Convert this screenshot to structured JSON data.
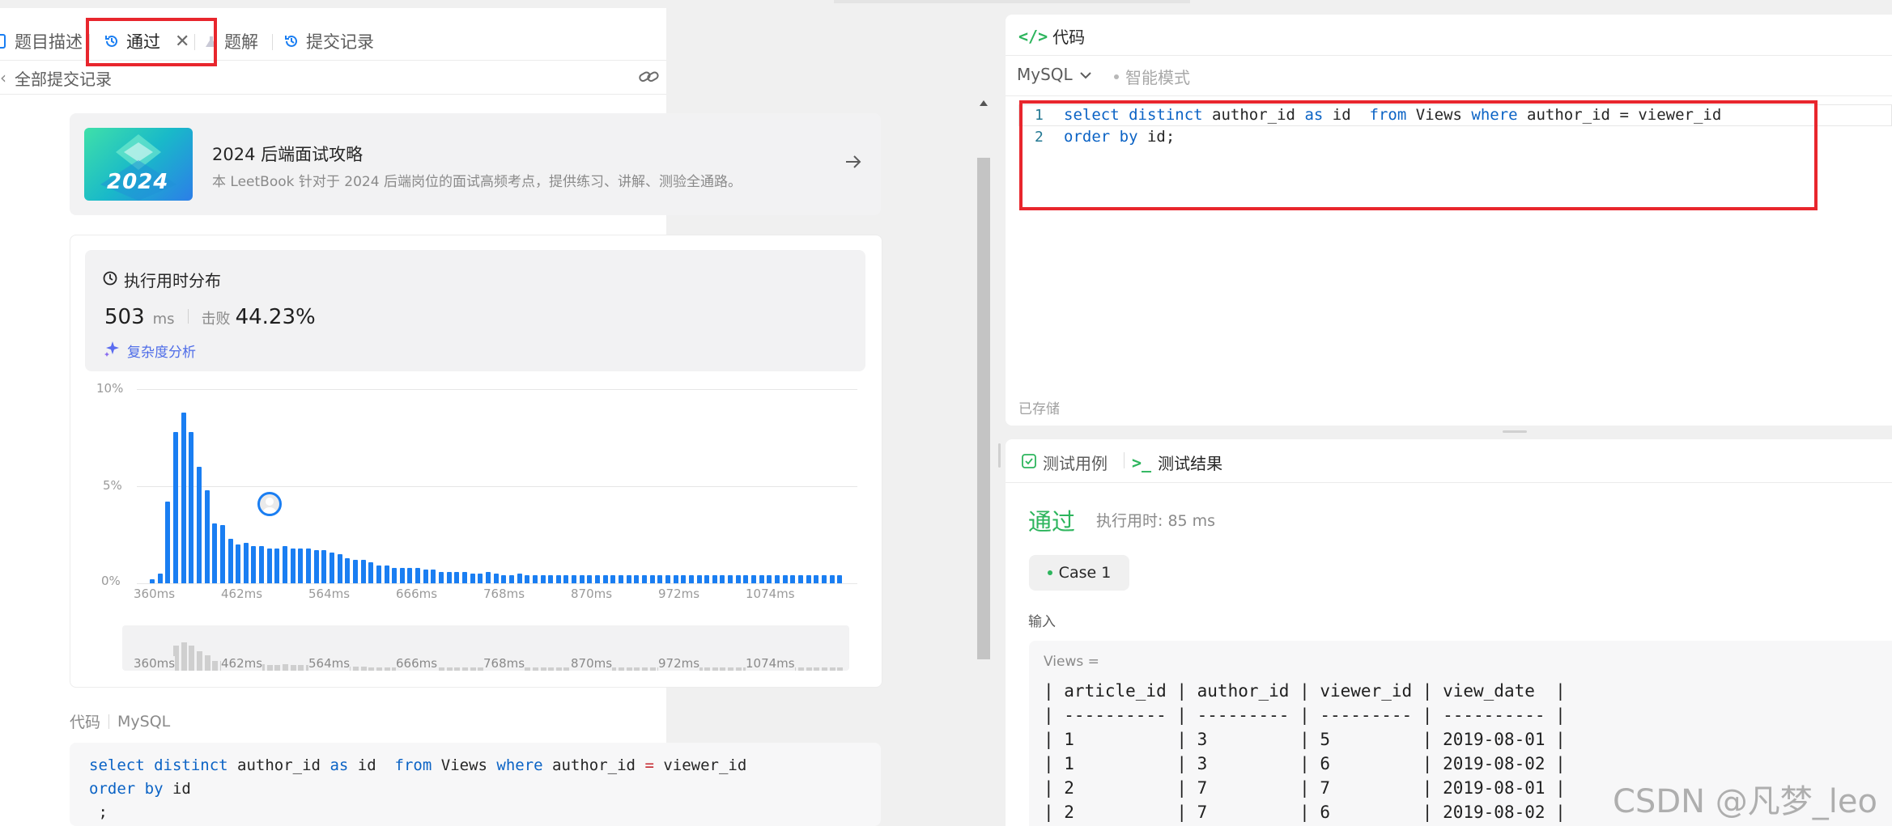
{
  "tabs": {
    "description": "题目描述",
    "accepted": "通过",
    "solution": "题解",
    "submissions": "提交记录"
  },
  "back_link": "全部提交记录",
  "promo": {
    "badge": "2024",
    "title": "2024 后端面试攻略",
    "subtitle": "本 LeetBook 针对于 2024 后端岗位的面试高频考点，提供练习、讲解、测验全通路。"
  },
  "runtime": {
    "heading": "执行用时分布",
    "value": "503",
    "unit": "ms",
    "beats_label": "击败",
    "beats_value": "44.23%",
    "complexity_label": "复杂度分析"
  },
  "chart_data": {
    "type": "bar",
    "title": "",
    "xlabel": "",
    "ylabel": "",
    "ylim": [
      0,
      10
    ],
    "y_ticks": [
      "10%",
      "5%",
      "0%"
    ],
    "x_ticks": [
      "360ms",
      "462ms",
      "564ms",
      "666ms",
      "768ms",
      "870ms",
      "972ms",
      "1074ms"
    ],
    "values": [
      0.2,
      0.5,
      4.2,
      7.8,
      8.8,
      7.8,
      6.0,
      4.8,
      3.1,
      3.0,
      2.3,
      2.0,
      2.1,
      1.9,
      1.9,
      1.8,
      1.8,
      1.9,
      1.8,
      1.8,
      1.8,
      1.7,
      1.7,
      1.6,
      1.5,
      1.3,
      1.2,
      1.2,
      1.1,
      0.9,
      0.9,
      0.8,
      0.8,
      0.8,
      0.8,
      0.7,
      0.7,
      0.6,
      0.6,
      0.6,
      0.6,
      0.5,
      0.5,
      0.6,
      0.5,
      0.4,
      0.4,
      0.5,
      0.4,
      0.4,
      0.4,
      0.4,
      0.4,
      0.4,
      0.4,
      0.4,
      0.4,
      0.4,
      0.4,
      0.4,
      0.4,
      0.4,
      0.4,
      0.4,
      0.4,
      0.4,
      0.4,
      0.4,
      0.4,
      0.4,
      0.4,
      0.4,
      0.4,
      0.4,
      0.4,
      0.4,
      0.4,
      0.4,
      0.4,
      0.4,
      0.4,
      0.4,
      0.4,
      0.4,
      0.4,
      0.4,
      0.4,
      0.4,
      0.4
    ],
    "marker_index": 15,
    "grid": true,
    "color": "#1a7ef2"
  },
  "left_code": {
    "label": "代码",
    "lang": "MySQL",
    "line1": {
      "kw1": "select",
      "kw2": "distinct",
      "t1": " author_id ",
      "kw3": "as",
      "t2": " id  ",
      "kw4": "from",
      "t3": " Views ",
      "kw5": "where",
      "t4": " author_id ",
      "op": "=",
      "t5": " viewer_id"
    },
    "line2": {
      "kw1": "order",
      "kw2": "by",
      "t1": " id"
    },
    "line3": " ;"
  },
  "editor": {
    "title": "代码",
    "lang": "MySQL",
    "mode": "智能模式",
    "saved": "已存储",
    "line_numbers": [
      "1",
      "2"
    ],
    "line1": {
      "kw1": "select",
      "kw2": "distinct",
      "t1": " author_id ",
      "kw3": "as",
      "t2": " id  ",
      "kw4": "from",
      "t3": " Views ",
      "kw5": "where",
      "t4": " author_id ",
      "op": "=",
      "t5": " viewer_id"
    },
    "line2": {
      "kw1": "order",
      "kw2": "by",
      "t1": " id;"
    }
  },
  "results": {
    "tab_cases": "测试用例",
    "tab_result": "测试结果",
    "status": "通过",
    "runtime": "执行用时: 85 ms",
    "case_label": "Case 1",
    "input_label": "输入",
    "views_label": "Views =",
    "table_lines": [
      "| article_id | author_id | viewer_id | view_date  |",
      "| ---------- | --------- | --------- | ---------- |",
      "| 1          | 3         | 5         | 2019-08-01 |",
      "| 1          | 3         | 6         | 2019-08-02 |",
      "| 2          | 7         | 7         | 2019-08-01 |",
      "| 2          | 7         | 6         | 2019-08-02 |"
    ]
  },
  "watermark": "CSDN @凡梦_leo",
  "colors": {
    "accent": "#1a7ef2",
    "success": "#2db55d",
    "highlight_box": "#e8262d"
  }
}
